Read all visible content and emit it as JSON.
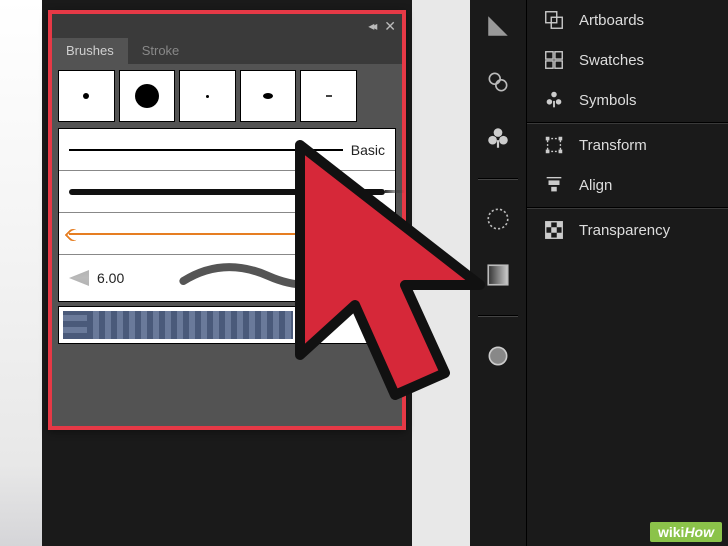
{
  "panel": {
    "tabs": {
      "brushes": "Brushes",
      "stroke": "Stroke"
    },
    "basic_label": "Basic",
    "width_value": "6.00"
  },
  "menu": {
    "artboards": "Artboards",
    "swatches": "Swatches",
    "symbols": "Symbols",
    "transform": "Transform",
    "align": "Align",
    "transparency": "Transparency"
  },
  "watermark": {
    "brand": "wiki",
    "suffix": "How"
  }
}
